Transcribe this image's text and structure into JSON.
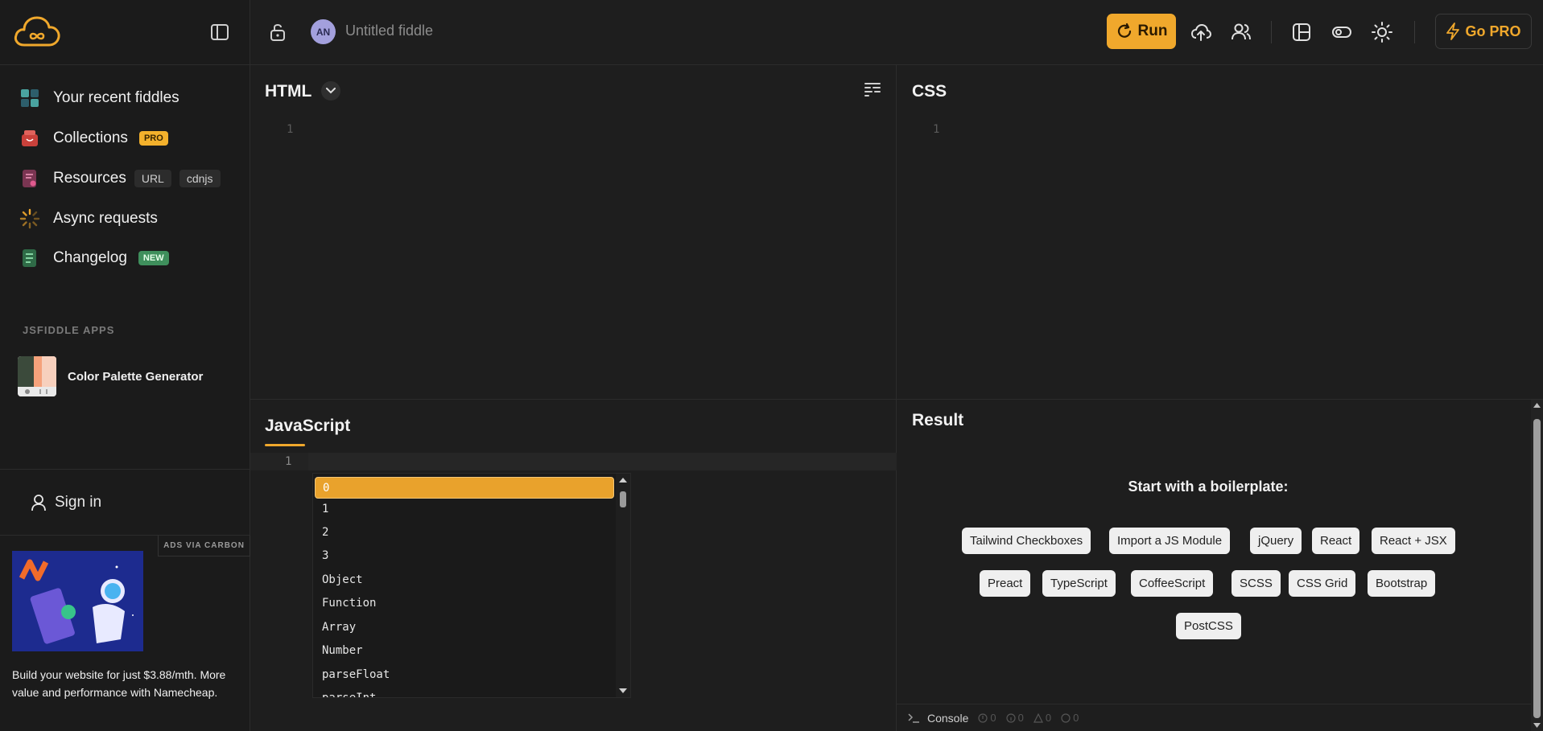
{
  "sidebar": {
    "nav": [
      {
        "label": "Your recent fiddles",
        "icon": "grid-icon"
      },
      {
        "label": "Collections",
        "icon": "collections-icon",
        "badge": "PRO"
      },
      {
        "label": "Resources",
        "icon": "resources-icon",
        "tags": [
          "URL",
          "cdnjs"
        ]
      },
      {
        "label": "Async requests",
        "icon": "spinner-icon"
      },
      {
        "label": "Changelog",
        "icon": "changelog-icon",
        "badge": "NEW"
      }
    ],
    "apps_header": "JSFIDDLE APPS",
    "apps": [
      {
        "label": "Color Palette Generator"
      }
    ],
    "sign_in": "Sign in",
    "ads_label": "ADS VIA CARBON",
    "ad_text": "Build your website for just $3.88/mth. More value and performance with Namecheap."
  },
  "topbar": {
    "avatar_initials": "AN",
    "title": "Untitled fiddle",
    "run_label": "Run",
    "gopro_label": "Go PRO"
  },
  "panels": {
    "html": {
      "title": "HTML",
      "line": "1"
    },
    "css": {
      "title": "CSS",
      "line": "1"
    },
    "js": {
      "title": "JavaScript",
      "line": "1"
    },
    "result": {
      "title": "Result"
    }
  },
  "autocomplete": [
    "0",
    "1",
    "2",
    "3",
    "Object",
    "Function",
    "Array",
    "Number",
    "parseFloat",
    "parseInt"
  ],
  "result": {
    "boilerplate_title": "Start with a boilerplate:",
    "boilerplates": [
      "Tailwind Checkboxes",
      "Import a JS Module",
      "jQuery",
      "React",
      "React + JSX",
      "Preact",
      "TypeScript",
      "CoffeeScript",
      "SCSS",
      "CSS Grid",
      "Bootstrap",
      "PostCSS"
    ],
    "console_label": "Console",
    "counts": [
      "0",
      "0",
      "0",
      "0"
    ]
  },
  "colors": {
    "accent": "#f0a82c",
    "background": "#1e1e1e",
    "sidebar": "#1b1b1b"
  }
}
